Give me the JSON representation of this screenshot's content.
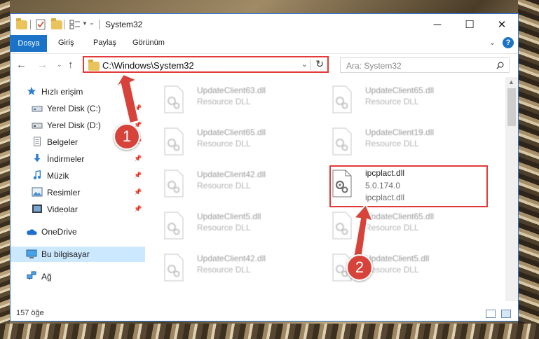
{
  "window": {
    "title": "System32"
  },
  "ribbon": {
    "tabs": [
      {
        "label": "Dosya"
      },
      {
        "label": "Giriş"
      },
      {
        "label": "Paylaş"
      },
      {
        "label": "Görünüm"
      }
    ]
  },
  "nav": {
    "address": "C:\\Windows\\System32",
    "search_placeholder": "Ara: System32"
  },
  "sidebar": {
    "items": [
      {
        "label": "Hızlı erişim",
        "icon": "star-icon"
      },
      {
        "label": "Yerel Disk (C:)",
        "icon": "drive-icon"
      },
      {
        "label": "Yerel Disk (D:)",
        "icon": "drive-icon"
      },
      {
        "label": "Belgeler",
        "icon": "documents-icon"
      },
      {
        "label": "İndirmeler",
        "icon": "download-icon"
      },
      {
        "label": "Müzik",
        "icon": "music-icon"
      },
      {
        "label": "Resimler",
        "icon": "pictures-icon"
      },
      {
        "label": "Videolar",
        "icon": "videos-icon"
      },
      {
        "label": "OneDrive",
        "icon": "cloud-icon"
      },
      {
        "label": "Bu bilgisayar",
        "icon": "computer-icon"
      },
      {
        "label": "Ağ",
        "icon": "network-icon"
      }
    ]
  },
  "files": [
    {
      "name": "UpdateClient63.dll",
      "desc": "Resource DLL"
    },
    {
      "name": "UpdateClient65.dll",
      "desc": "Resource DLL"
    },
    {
      "name": "UpdateClient65.dll",
      "desc": "Resource DLL"
    },
    {
      "name": "UpdateClient19.dll",
      "desc": "Resource DLL"
    },
    {
      "name": "UpdateClient42.dll",
      "desc": "Resource DLL"
    },
    {
      "name": "ipcplact.dll",
      "version": "5.0.174.0",
      "desc": "ipcplact.dll"
    },
    {
      "name": "UpdateClient5.dll",
      "desc": "Resource DLL"
    },
    {
      "name": "UpdateClient65.dll",
      "desc": "Resource DLL"
    },
    {
      "name": "UpdateClient42.dll",
      "desc": "Resource DLL"
    },
    {
      "name": "UpdateClient5.dll",
      "desc": "Resource DLL"
    }
  ],
  "status": {
    "count": "157 öğe"
  },
  "annotations": {
    "step1": "1",
    "step2": "2",
    "color": "#d7433a"
  },
  "colors": {
    "accent": "#1a73c7",
    "selected": "#cce8ff",
    "highlight_border": "#e23a3a"
  }
}
